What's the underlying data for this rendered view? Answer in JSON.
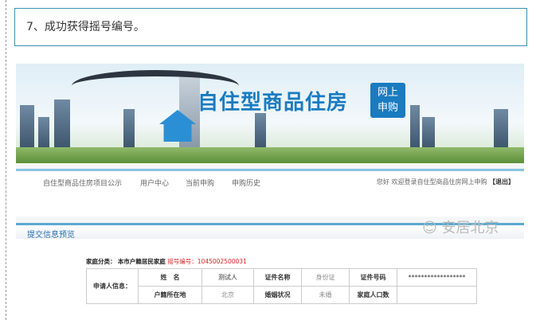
{
  "step_text": "7、成功获得摇号编号。",
  "banner": {
    "title": "自住型商品住房",
    "badge_line1": "网上",
    "badge_line2": "申购"
  },
  "nav": {
    "items": [
      "自住型商品住房项目公示",
      "用户中心",
      "当前申购",
      "申购历史"
    ],
    "welcome": "您好 欢迎登录自住型商品住房网上申购",
    "logout": "【退出】"
  },
  "section_title": "提交信息预览",
  "family": {
    "label": "家庭分类：",
    "value": "本市户籍居民家庭",
    "lottery_label": "摇号编号：",
    "lottery_number": "1045002500031"
  },
  "table": {
    "applicant_label": "申请人信息：",
    "row1": [
      "姓　名",
      "测试人",
      "证件名称",
      "身份证",
      "证件号码",
      "******************"
    ],
    "row2": [
      "户籍所在地",
      "北京",
      "婚姻状况",
      "未婚",
      "家庭人口数",
      ""
    ]
  },
  "watermark": "安居北京"
}
